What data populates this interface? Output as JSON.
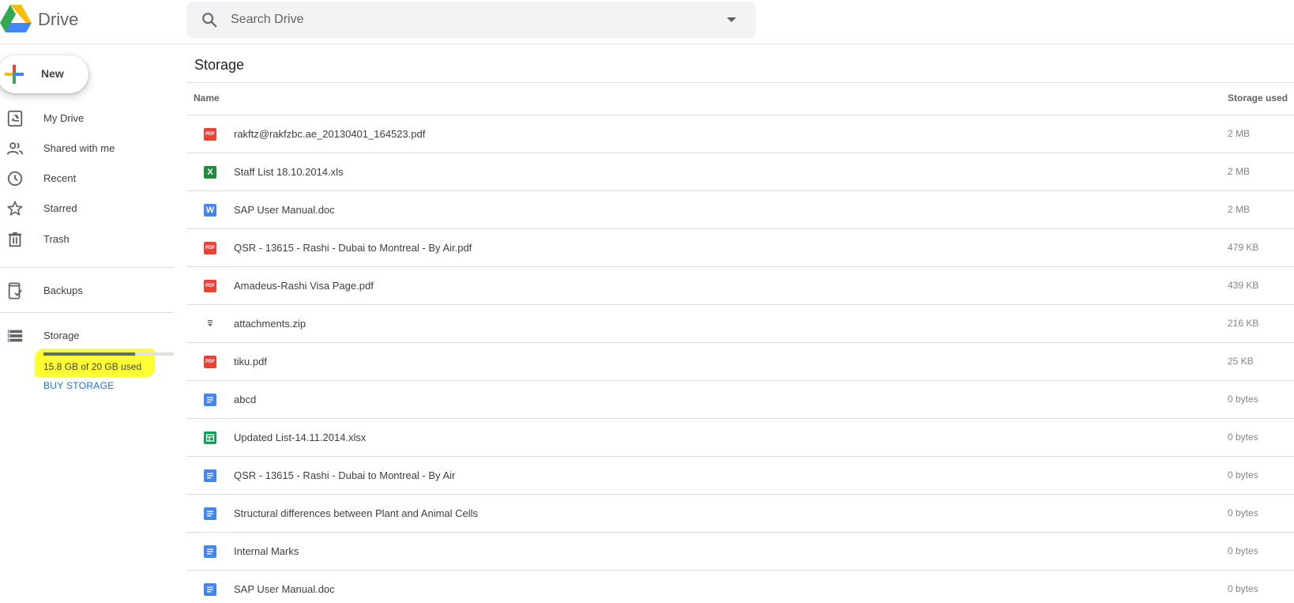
{
  "app": {
    "name": "Drive"
  },
  "search": {
    "placeholder": "Search Drive"
  },
  "new_button": {
    "label": "New"
  },
  "sidebar": {
    "items": [
      {
        "label": "My Drive",
        "icon": "my-drive-icon"
      },
      {
        "label": "Shared with me",
        "icon": "people-icon"
      },
      {
        "label": "Recent",
        "icon": "clock-icon"
      },
      {
        "label": "Starred",
        "icon": "star-icon"
      },
      {
        "label": "Trash",
        "icon": "trash-icon"
      }
    ],
    "backups": {
      "label": "Backups",
      "icon": "backup-phone-icon"
    },
    "storage": {
      "label": "Storage",
      "icon": "storage-icon",
      "used_text": "15.8 GB of 20 GB used",
      "used_fraction": 0.79,
      "buy_label": "BUY STORAGE",
      "highlight_color": "#ffff33"
    }
  },
  "main": {
    "title": "Storage",
    "columns": {
      "name": "Name",
      "size": "Storage used"
    },
    "files": [
      {
        "name": "rakftz@rakfzbc.ae_20130401_164523.pdf",
        "size": "2 MB",
        "type": "pdf",
        "icon_text": "PDF"
      },
      {
        "name": "Staff List 18.10.2014.xls",
        "size": "2 MB",
        "type": "xls",
        "icon_text": "X"
      },
      {
        "name": "SAP User Manual.doc",
        "size": "2 MB",
        "type": "word",
        "icon_text": "W"
      },
      {
        "name": "QSR - 13615 - Rashi - Dubai to Montreal - By Air.pdf",
        "size": "479 KB",
        "type": "pdf",
        "icon_text": "PDF"
      },
      {
        "name": "Amadeus-Rashi Visa Page.pdf",
        "size": "439 KB",
        "type": "pdf",
        "icon_text": "PDF"
      },
      {
        "name": "attachments.zip",
        "size": "216 KB",
        "type": "zip",
        "icon_text": ""
      },
      {
        "name": "tiku.pdf",
        "size": "25 KB",
        "type": "pdf",
        "icon_text": "PDF"
      },
      {
        "name": "abcd",
        "size": "0 bytes",
        "type": "doc",
        "icon_text": ""
      },
      {
        "name": "Updated List-14.11.2014.xlsx",
        "size": "0 bytes",
        "type": "sheet",
        "icon_text": ""
      },
      {
        "name": "QSR - 13615 - Rashi - Dubai to Montreal - By Air",
        "size": "0 bytes",
        "type": "doc",
        "icon_text": ""
      },
      {
        "name": "Structural differences between Plant and Animal Cells",
        "size": "0 bytes",
        "type": "doc",
        "icon_text": ""
      },
      {
        "name": "Internal Marks",
        "size": "0 bytes",
        "type": "doc",
        "icon_text": ""
      },
      {
        "name": "SAP User Manual.doc",
        "size": "0 bytes",
        "type": "doc",
        "icon_text": ""
      }
    ]
  },
  "colors": {
    "google_blue": "#4285f4",
    "google_red": "#ea4335",
    "google_yellow": "#fbbc04",
    "google_green": "#34a853",
    "link_blue": "#1a73e8"
  }
}
